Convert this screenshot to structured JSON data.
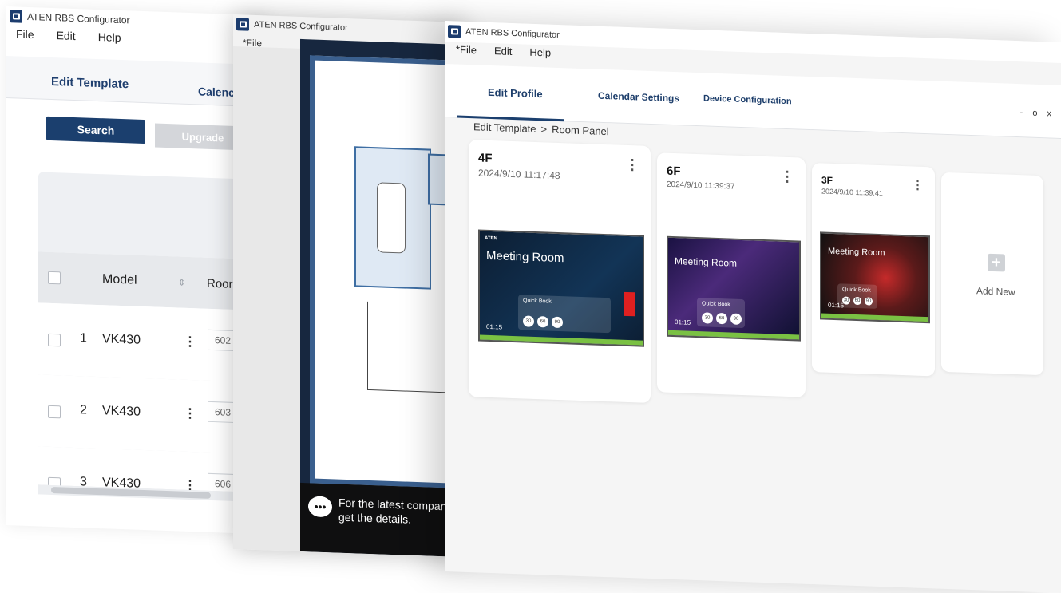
{
  "app_title": "ATEN RBS Configurator",
  "window1": {
    "menu": [
      "File",
      "Edit",
      "Help"
    ],
    "tabs": [
      "Edit Template",
      "Calenc"
    ],
    "buttons": {
      "search": "Search",
      "upgrade": "Upgrade"
    },
    "table": {
      "headers": {
        "model": "Model",
        "room": "Roor"
      },
      "rows": [
        {
          "num": "1",
          "model": "VK430",
          "room": "602"
        },
        {
          "num": "2",
          "model": "VK430",
          "room": "603"
        },
        {
          "num": "3",
          "model": "VK430",
          "room": "606"
        }
      ]
    }
  },
  "window2": {
    "menu_file": "*File",
    "banner_text": "For the latest company i get the details."
  },
  "window3": {
    "menu": [
      "*File",
      "Edit",
      "Help"
    ],
    "tabs": [
      "Edit Profile",
      "Calendar Settings",
      "Device Configuration"
    ],
    "window_controls": [
      "-",
      "o",
      "x"
    ],
    "breadcrumb": [
      "Edit Template",
      ">",
      "Room Panel"
    ],
    "cards": [
      {
        "floor": "4F",
        "date": "2024/9/10 11:17:48",
        "panel_title": "Meeting Room",
        "quick_book": "Quick Book",
        "time": "01:15",
        "buttons": [
          "30",
          "60",
          "90"
        ]
      },
      {
        "floor": "6F",
        "date": "2024/9/10 11:39:37",
        "panel_title": "Meeting Room",
        "quick_book": "Quick Book",
        "time": "01:15",
        "buttons": [
          "30",
          "60",
          "90"
        ]
      },
      {
        "floor": "3F",
        "date": "2024/9/10 11:39:41",
        "panel_title": "Meeting Room",
        "quick_book": "Quick Book",
        "time": "01:15",
        "buttons": [
          "30",
          "60",
          "90"
        ]
      }
    ],
    "add_new": "Add New"
  },
  "colors": {
    "brand": "#1b3f6e",
    "accent_green": "#7ac143"
  }
}
